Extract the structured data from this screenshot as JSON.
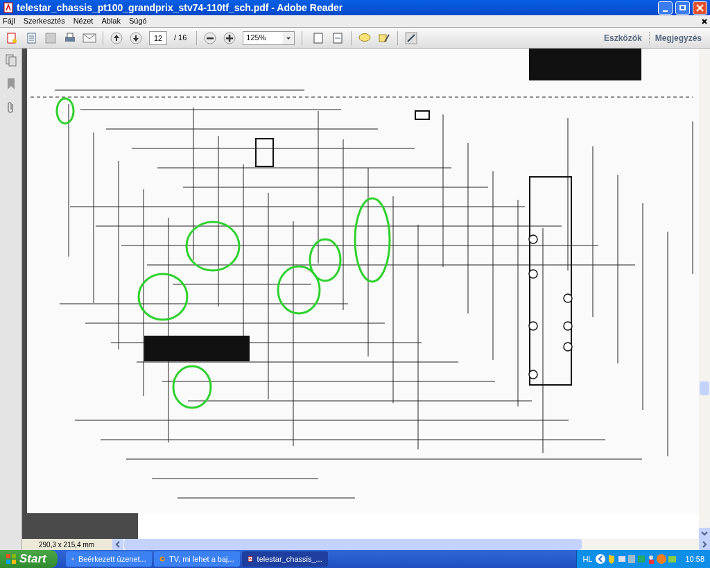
{
  "window": {
    "title": "telestar_chassis_pt100_grandprix_stv74-110tf_sch.pdf - Adobe Reader"
  },
  "menu": [
    "Fájl",
    "Szerkesztés",
    "Nézet",
    "Ablak",
    "Súgó"
  ],
  "toolbar": {
    "page": "12",
    "page_total": "/ 16",
    "zoom": "125%",
    "panes": [
      "Eszközök",
      "Megjegyzés"
    ]
  },
  "status_bar": {
    "page_size": "290,3 x 215,4 mm"
  },
  "taskbar": {
    "start": "Start",
    "tasks": [
      {
        "label": "Beérkezett üzenet...",
        "kind": "mail",
        "selected": false
      },
      {
        "label": "TV, mi lehet a baj...",
        "kind": "browser",
        "selected": false
      },
      {
        "label": "telestar_chassis_...",
        "kind": "pdf",
        "selected": true
      }
    ],
    "language": "HL",
    "clock": "10:58"
  }
}
